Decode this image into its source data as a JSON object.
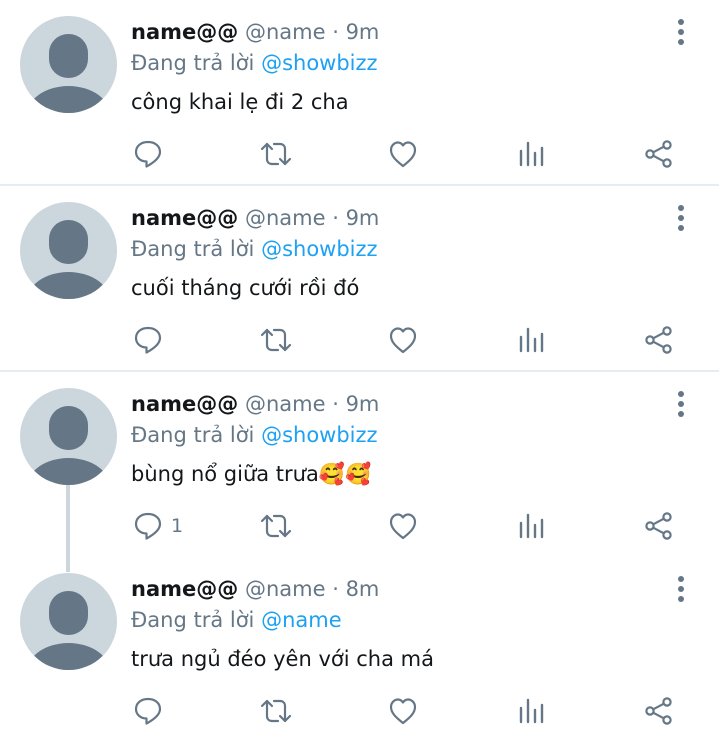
{
  "tweets": [
    {
      "display_name": "name@@",
      "handle": "@name",
      "dot": "·",
      "time": "9m",
      "reply_prefix": "Đang trả lời",
      "reply_to": "@showbizz",
      "text": "công khai lẹ đi 2 cha",
      "reply_count": ""
    },
    {
      "display_name": "name@@",
      "handle": "@name",
      "dot": "·",
      "time": "9m",
      "reply_prefix": "Đang trả lời",
      "reply_to": "@showbizz",
      "text": "cuối tháng cưới rồi đó",
      "reply_count": ""
    },
    {
      "display_name": "name@@",
      "handle": "@name",
      "dot": "·",
      "time": "9m",
      "reply_prefix": "Đang trả lời",
      "reply_to": "@showbizz",
      "text": "bùng nổ giữa trưa🥰🥰",
      "reply_count": "1"
    },
    {
      "display_name": "name@@",
      "handle": "@name",
      "dot": "·",
      "time": "8m",
      "reply_prefix": "Đang trả lời",
      "reply_to": "@name",
      "text": "trưa ngủ đéo yên với cha má",
      "reply_count": ""
    }
  ],
  "icons": {
    "reply": "reply-icon",
    "retweet": "retweet-icon",
    "like": "heart-icon",
    "analytics": "analytics-icon",
    "share": "share-icon",
    "more": "more-vertical-icon",
    "avatar": "default-avatar-icon"
  },
  "colors": {
    "name": "#14171a",
    "secondary": "#657786",
    "mention": "#1da1f2",
    "divider": "#e6ecf0",
    "avatar_bg": "#ccd6dd",
    "avatar_fg": "#657786"
  }
}
